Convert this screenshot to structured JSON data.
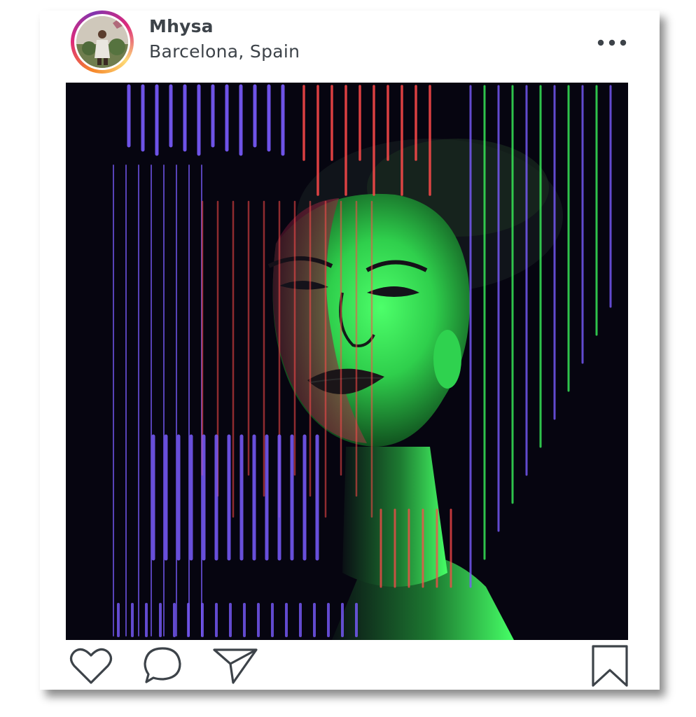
{
  "post": {
    "username": "Mhysa",
    "location": "Barcelona, Spain"
  },
  "icons": {
    "more": "more-horizontal-icon",
    "like": "heart-icon",
    "comment": "comment-bubble-icon",
    "share": "send-paper-plane-icon",
    "save": "bookmark-icon"
  },
  "colors": {
    "text": "#3d4349",
    "neon_green": "#39f25a",
    "neon_violet": "#7a5cff",
    "neon_red": "#ff4a4a",
    "photo_background": "#060510"
  }
}
